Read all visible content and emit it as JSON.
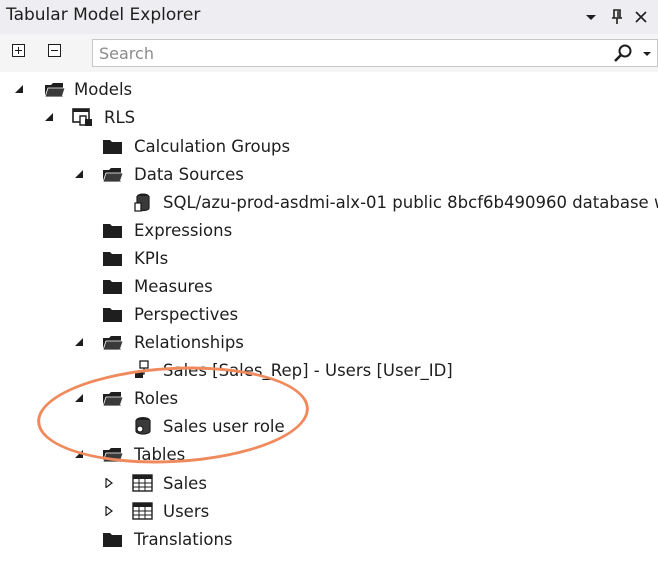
{
  "panel": {
    "title": "Tabular Model Explorer",
    "buttons": [
      "dropdown-icon",
      "pin-icon",
      "close-icon"
    ]
  },
  "toolbar": {
    "expand_icon": "expand-all-icon",
    "collapse_icon": "collapse-all-icon",
    "search_placeholder": "Search",
    "search_value": ""
  },
  "tree": {
    "models": "Models",
    "rls": "RLS",
    "calculation_groups": "Calculation Groups",
    "data_sources": "Data Sources",
    "data_source_item": "SQL/azu-prod-asdmi-alx-01 public 8bcf6b490960 database w",
    "expressions": "Expressions",
    "kpis": "KPIs",
    "measures": "Measures",
    "perspectives": "Perspectives",
    "relationships": "Relationships",
    "relationship_item": "Sales [Sales_Rep] - Users [User_ID]",
    "roles": "Roles",
    "role_item": "Sales user role",
    "tables": "Tables",
    "table_sales": "Sales",
    "table_users": "Users",
    "translations": "Translations"
  },
  "colors": {
    "highlight_ellipse": "#f08a5d",
    "titlebar": "#eeeef2",
    "text": "#1e1e1e"
  }
}
